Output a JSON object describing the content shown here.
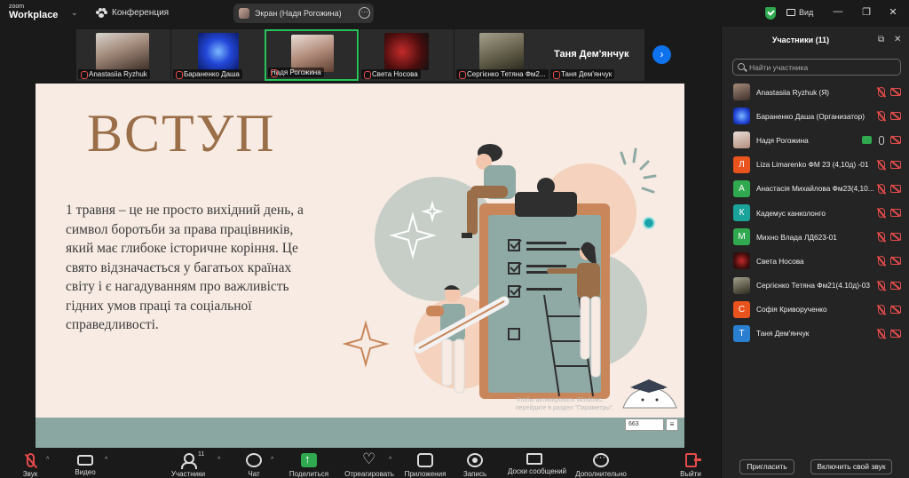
{
  "app": {
    "logo_small": "zoom",
    "logo_big": "Workplace",
    "meeting_label": "Конференция",
    "screen_share_label": "Экран (Надя Рогожина)",
    "view_label": "Вид"
  },
  "thumbnails": [
    {
      "name": "Anastasiia Ryzhuk",
      "active": false
    },
    {
      "name": "Бараненко Даша",
      "active": false
    },
    {
      "name": "Надя Рогожина",
      "active": true
    },
    {
      "name": "Света Носова",
      "active": false
    },
    {
      "name": "Сергієнко Тетяна Фм2...",
      "active": false
    },
    {
      "name": "Таня Дем'янчук",
      "big_name": "Таня Дем'янчук",
      "active": false
    }
  ],
  "slide": {
    "title": "ВСТУП",
    "body": "1 травня – це не просто вихідний день, а символ боротьби за права працівників, який має глибоке історичне коріння. Це свято відзначається у багатьох країнах світу і є нагадуванням про важливість гідних умов праці та соціальної справедливості.",
    "watermark": "Чтобы активировать Windows, перейдите в раздел \"Параметры\".",
    "counter": "663"
  },
  "panel": {
    "title": "Участники (11)",
    "search_placeholder": "Найти участника",
    "participants": [
      {
        "name": "Anastasiia Ryzhuk (Я)",
        "initial": "",
        "color": "#6b5a4e",
        "mic": "off",
        "cam": "off"
      },
      {
        "name": "Бараненко Даша (Организатор)",
        "initial": "",
        "color": "#2d4fd6",
        "mic": "off",
        "cam": "off"
      },
      {
        "name": "Надя Рогожина",
        "initial": "",
        "color": "#c9a89a",
        "mic": "on",
        "cam": "on"
      },
      {
        "name": "Liza Limarenko ФМ 23 (4,10д) -01",
        "initial": "Л",
        "color": "#e8531e",
        "mic": "off",
        "cam": "off"
      },
      {
        "name": "Анастасія Михайлова Фм23(4,10...",
        "initial": "А",
        "color": "#2fa84f",
        "mic": "off",
        "cam": "off"
      },
      {
        "name": "Кадемус канколонго",
        "initial": "К",
        "color": "#1aa39a",
        "mic": "off",
        "cam": "off"
      },
      {
        "name": "Михно Влада ЛД623-01",
        "initial": "М",
        "color": "#2fa84f",
        "mic": "off",
        "cam": "off"
      },
      {
        "name": "Света Носова",
        "initial": "",
        "color": "#7a1c1c",
        "mic": "off",
        "cam": "off"
      },
      {
        "name": "Сергієнко Тетяна Фм21(4.10д)-03",
        "initial": "",
        "color": "#6e6a55",
        "mic": "off",
        "cam": "off"
      },
      {
        "name": "Софія Криворученко",
        "initial": "С",
        "color": "#e8531e",
        "mic": "off",
        "cam": "off"
      },
      {
        "name": "Таня Дем'янчук",
        "initial": "Т",
        "color": "#2a7fd0",
        "mic": "off",
        "cam": "off"
      }
    ],
    "invite_label": "Пригласить",
    "unmute_label": "Включить свой звук"
  },
  "toolbar": {
    "audio": "Звук",
    "video": "Видео",
    "participants": "Участники",
    "participants_count": "11",
    "chat": "Чат",
    "share": "Поделиться",
    "react": "Отреагировать",
    "apps": "Приложения",
    "record": "Запись",
    "whiteboards": "Доски сообщений",
    "more": "Дополнительно",
    "leave": "Выйти"
  }
}
